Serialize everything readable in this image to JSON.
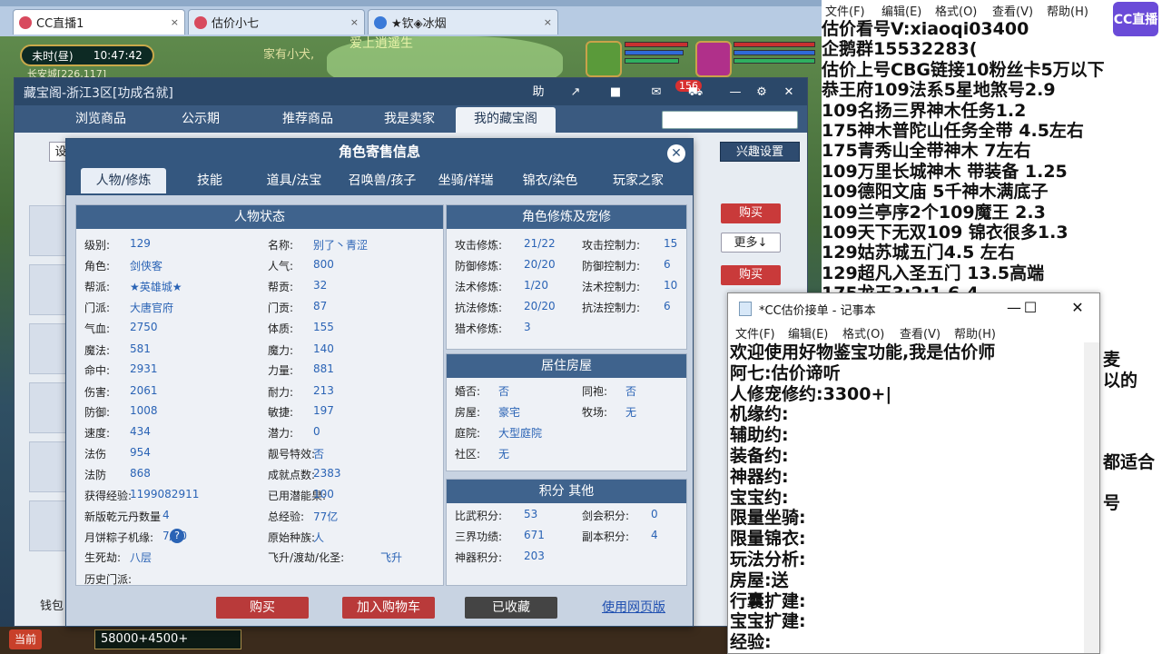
{
  "browser": {
    "tabs": [
      {
        "label": "CC直播1",
        "close": "×"
      },
      {
        "label": "估价小七",
        "close": "×"
      },
      {
        "label": "★钦◈冰烟",
        "close": "×"
      }
    ]
  },
  "game": {
    "time": "未时(昼)",
    "clock": "10:47:42",
    "location": "长安城[226,117]",
    "scene_text_1": "家有小犬,",
    "scene_text_2": "爱上逍遥生",
    "bottom_current": "当前",
    "bottom_input": "58000+4500+"
  },
  "cbg": {
    "title": "藏宝阁-浙江3区[功成名就]",
    "title_btn_help": "助",
    "badge": "156",
    "nav": [
      "浏览商品",
      "公示期",
      "推荐商品",
      "我是卖家",
      "我的藏宝阁"
    ],
    "fav_button": "兴趣设置",
    "left_setting": "设",
    "buy_1": "购买",
    "more": "更多↓",
    "buy_2": "购买",
    "wallet": "钱包"
  },
  "modal": {
    "title": "角色寄售信息",
    "close": "✕",
    "tabs": [
      "人物/修炼",
      "技能",
      "道具/法宝",
      "召唤兽/孩子",
      "坐骑/祥瑞",
      "锦衣/染色",
      "玩家之家"
    ],
    "status_title": "人物状态",
    "status_left": [
      {
        "k": "级别:",
        "v": "129"
      },
      {
        "k": "角色:",
        "v": "剑侠客"
      },
      {
        "k": "帮派:",
        "v": "★英雄城★"
      },
      {
        "k": "门派:",
        "v": "大唐官府"
      },
      {
        "k": "气血:",
        "v": "2750"
      },
      {
        "k": "魔法:",
        "v": "581"
      },
      {
        "k": "命中:",
        "v": "2931"
      },
      {
        "k": "伤害:",
        "v": "2061"
      },
      {
        "k": "防御:",
        "v": "1008"
      },
      {
        "k": "速度:",
        "v": "434"
      },
      {
        "k": "法伤",
        "v": "954"
      },
      {
        "k": "法防",
        "v": "868"
      },
      {
        "k": "获得经验:",
        "v": "1199082911"
      },
      {
        "k": "新版乾元丹数量",
        "v": "4"
      },
      {
        "k": "月饼粽子机缘:",
        "v": "7/60"
      },
      {
        "k": "生死劫:",
        "v": "八层"
      },
      {
        "k": "历史门派:",
        "v": ""
      }
    ],
    "status_right": [
      {
        "k": "名称:",
        "v": "别了丶青涩"
      },
      {
        "k": "人气:",
        "v": "800"
      },
      {
        "k": "帮贡:",
        "v": "32"
      },
      {
        "k": "门贡:",
        "v": "87"
      },
      {
        "k": "体质:",
        "v": "155"
      },
      {
        "k": "魔力:",
        "v": "140"
      },
      {
        "k": "力量:",
        "v": "881"
      },
      {
        "k": "耐力:",
        "v": "213"
      },
      {
        "k": "敏捷:",
        "v": "197"
      },
      {
        "k": "潜力:",
        "v": "0"
      },
      {
        "k": "靓号特效:",
        "v": "否"
      },
      {
        "k": "成就点数:",
        "v": "2383"
      },
      {
        "k": "已用潜能果:",
        "v": "100"
      },
      {
        "k": "总经验:",
        "v": "77亿"
      },
      {
        "k": "原始种族:",
        "v": "人"
      },
      {
        "k": "飞升/渡劫/化圣:",
        "v": "飞升"
      }
    ],
    "cultivation_title": "角色修炼及宠修",
    "cultivation": [
      {
        "k": "攻击修炼:",
        "v": "21/22",
        "k2": "攻击控制力:",
        "v2": "15"
      },
      {
        "k": "防御修炼:",
        "v": "20/20",
        "k2": "防御控制力:",
        "v2": "6"
      },
      {
        "k": "法术修炼:",
        "v": "1/20",
        "k2": "法术控制力:",
        "v2": "10"
      },
      {
        "k": "抗法修炼:",
        "v": "20/20",
        "k2": "抗法控制力:",
        "v2": "6"
      },
      {
        "k": "猎术修炼:",
        "v": "3",
        "k2": "",
        "v2": ""
      }
    ],
    "house_title": "居住房屋",
    "house": [
      {
        "k": "婚否:",
        "v": "否",
        "k2": "同袍:",
        "v2": "否"
      },
      {
        "k": "房屋:",
        "v": "豪宅",
        "k2": "牧场:",
        "v2": "无"
      },
      {
        "k": "庭院:",
        "v": "大型庭院",
        "k2": "",
        "v2": ""
      },
      {
        "k": "社区:",
        "v": "无",
        "k2": "",
        "v2": ""
      }
    ],
    "score_title": "积分 其他",
    "score": [
      {
        "k": "比武积分:",
        "v": "53",
        "k2": "剑会积分:",
        "v2": "0"
      },
      {
        "k": "三界功绩:",
        "v": "671",
        "k2": "副本积分:",
        "v2": "4"
      },
      {
        "k": "神器积分:",
        "v": "203",
        "k2": "",
        "v2": ""
      }
    ],
    "buttons": {
      "buy": "购买",
      "cart": "加入购物车",
      "fav": "已收藏",
      "web": "使用网页版"
    }
  },
  "overlay": {
    "menu": [
      "文件(F)",
      "编辑(E)",
      "格式(O)",
      "查看(V)",
      "帮助(H)"
    ],
    "logo": "CC直播",
    "lines": [
      "估价看号V:xiaoqi03400",
      "企鹅群15532283(",
      "估价上号CBG链接10粉丝卡5万以下",
      "恭王府109法系5星地煞号2.9",
      "109名扬三界神木任务1.2",
      "175神木普陀山任务全带 4.5左右",
      "175青秀山全带神木  7左右",
      "109万里长城神木 带装备  1.25",
      "109德阳文庙 5千神木满底子",
      "109兰亭序2个109魔王 2.3",
      "109天下无双109  锦衣很多1.3",
      "129姑苏城五门4.5 左右",
      "129超凡入圣五门  13.5高端",
      "175龙王3:2:1  6.4"
    ],
    "stray": [
      "麦",
      "以的",
      "都适合",
      "号"
    ]
  },
  "notepad": {
    "title": "*CC估价接单 - 记事本",
    "menu": [
      "文件(F)",
      "编辑(E)",
      "格式(O)",
      "查看(V)",
      "帮助(H)"
    ],
    "lines": [
      "欢迎使用好物鉴宝功能,我是估价师",
      "阿七:估价谛听",
      "人修宠修约:3300+|",
      "机缘约:",
      "辅助约:",
      "装备约:",
      "神器约:",
      "宝宝约:",
      "限量坐骑:",
      "限量锦衣:",
      "玩法分析:",
      "房屋:送",
      "行囊扩建:",
      "宝宝扩建:",
      "经验:"
    ]
  }
}
